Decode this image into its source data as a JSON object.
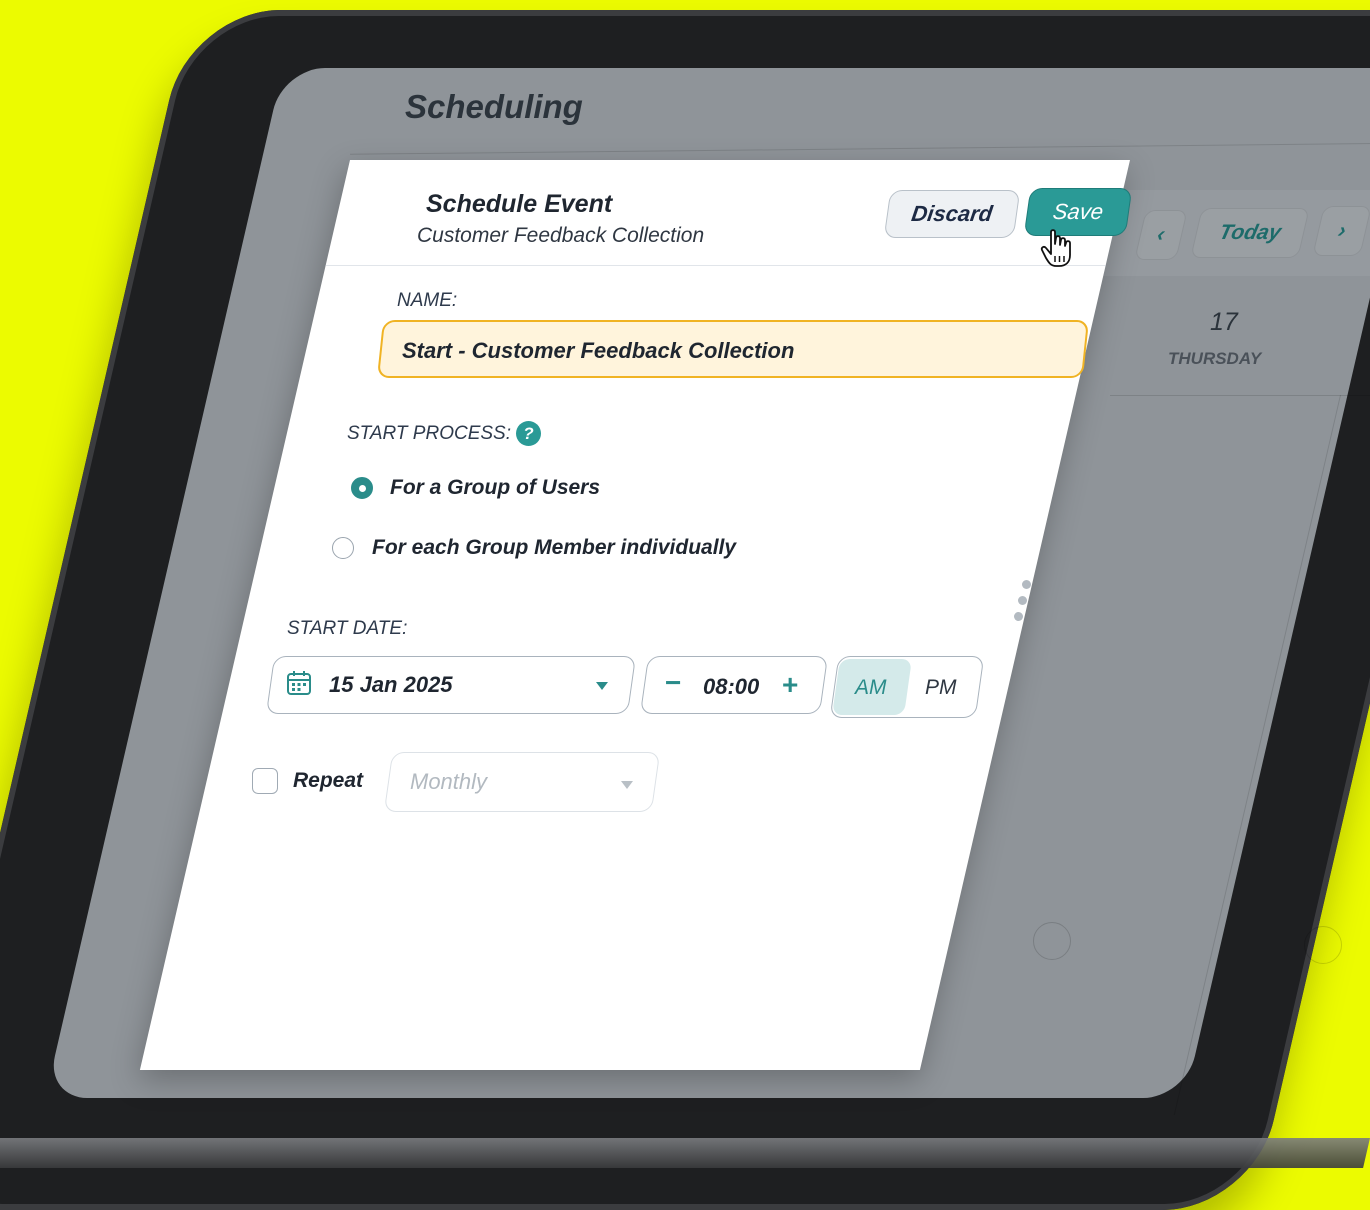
{
  "app": {
    "title": "Scheduling"
  },
  "calendar_toolbar": {
    "prev_icon": "chevron-left-icon",
    "today_label": "Today",
    "next_icon": "chevron-right-icon",
    "prev_glyph": "‹",
    "next_glyph": "›"
  },
  "calendar_day": {
    "number": "17",
    "name": "THURSDAY"
  },
  "modal": {
    "title": "Schedule Event",
    "subtitle": "Customer Feedback Collection",
    "discard_label": "Discard",
    "save_label": "Save",
    "name_label": "NAME:",
    "name_value": "Start - Customer Feedback Collection",
    "start_process_label": "START PROCESS:",
    "help_glyph": "?",
    "options": [
      {
        "label": "For a Group of Users",
        "selected": true
      },
      {
        "label": "For each Group Member individually",
        "selected": false
      }
    ],
    "start_date_label": "START DATE:",
    "date_value": "15 Jan 2025",
    "time_value": "08:00",
    "minus_glyph": "−",
    "plus_glyph": "+",
    "am_label": "AM",
    "pm_label": "PM",
    "selected_period": "AM",
    "repeat_label": "Repeat",
    "repeat_checked": false,
    "repeat_frequency": "Monthly"
  },
  "colors": {
    "background": "#ecfb00",
    "accent": "#2a9a96",
    "name_field_bg": "#fff4dc",
    "name_field_border": "#f0b324"
  }
}
